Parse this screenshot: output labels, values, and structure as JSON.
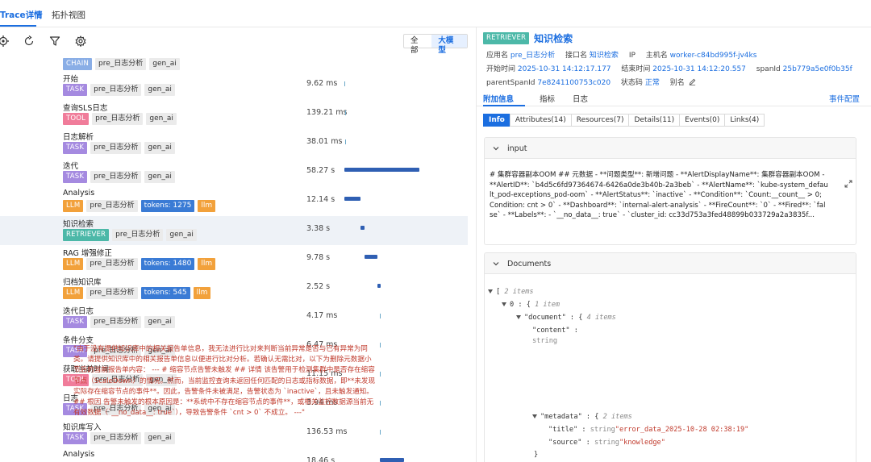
{
  "top_tabs": [
    "Trace详情",
    "拓扑视图"
  ],
  "toolbar": {
    "seg": [
      "全部",
      "大模型"
    ]
  },
  "colors": {
    "accent": "#1b6ee0",
    "task": "#a58ae0",
    "tool": "#f07c9a",
    "llm": "#f2a13b",
    "retriever": "#4cb8a8",
    "chain": "#8aaee6"
  },
  "spans": [
    {
      "name": "",
      "type": "CHAIN",
      "tags": [
        "pre_日志分析",
        "gen_ai"
      ],
      "duration": ""
    },
    {
      "name": "开始",
      "type": "TASK",
      "tags": [
        "pre_日志分析",
        "gen_ai"
      ],
      "duration": "9.62 ms"
    },
    {
      "name": "查询SLS日志",
      "type": "TOOL",
      "tags": [
        "pre_日志分析",
        "gen_ai"
      ],
      "duration": "139.21 ms"
    },
    {
      "name": "日志解析",
      "type": "TASK",
      "tags": [
        "pre_日志分析",
        "gen_ai"
      ],
      "duration": "38.01 ms"
    },
    {
      "name": "迭代",
      "type": "TASK",
      "tags": [
        "pre_日志分析",
        "gen_ai"
      ],
      "duration": "58.27 s"
    },
    {
      "name": "Analysis",
      "type": "LLM",
      "tags": [
        "pre_日志分析"
      ],
      "tokens": "tokens: 1275",
      "extra": "llm",
      "duration": "12.14 s"
    },
    {
      "name": "知识检索",
      "type": "RETRIEVER",
      "tags": [
        "pre_日志分析",
        "gen_ai"
      ],
      "duration": "3.38 s"
    },
    {
      "name": "RAG 增强修正",
      "type": "LLM",
      "tags": [
        "pre_日志分析"
      ],
      "tokens": "tokens: 1480",
      "extra": "llm",
      "duration": "9.78 s"
    },
    {
      "name": "归档知识库",
      "type": "LLM",
      "tags": [
        "pre_日志分析"
      ],
      "tokens": "tokens: 545",
      "extra": "llm",
      "duration": "2.52 s"
    },
    {
      "name": "迭代日志",
      "type": "TASK",
      "tags": [
        "pre_日志分析",
        "gen_ai"
      ],
      "duration": "4.17 ms"
    },
    {
      "name": "条件分支",
      "type": "TASK",
      "tags": [
        "pre_日志分析",
        "gen_ai"
      ],
      "duration": "6.47 ms"
    },
    {
      "name": "获取当前时间",
      "type": "TOOL",
      "tags": [
        "pre_日志分析",
        "gen_ai"
      ],
      "duration": "11.15 ms"
    },
    {
      "name": "日志",
      "type": "TASK",
      "tags": [
        "pre_日志分析",
        "gen_ai"
      ],
      "duration": "3.94 ms"
    },
    {
      "name": "知识库写入",
      "type": "TASK",
      "tags": [
        "pre_日志分析",
        "gen_ai"
      ],
      "duration": "136.53 ms"
    },
    {
      "name": "Analysis",
      "type": "",
      "tags": [],
      "duration": "18.46 s"
    }
  ],
  "detail": {
    "type_badge": "RETRIEVER",
    "title": "知识检索",
    "app_label": "应用名",
    "app": "pre_日志分析",
    "iface_label": "接口名",
    "iface": "知识检索",
    "ip_label": "IP",
    "host_label": "主机名",
    "host": "worker-c84bd995f-jv4ks",
    "start_label": "开始时间",
    "start": "2025-10-31 14:12:17.177",
    "end_label": "结束时间",
    "end": "2025-10-31 14:12:20.557",
    "spanid_label": "spanId",
    "spanid": "25b779a5e0f0b35f",
    "parent_label": "parentSpanId",
    "parent": "7e8241100753c020",
    "status_label": "状态码",
    "status": "正常",
    "alias_label": "别名"
  },
  "subtabs": [
    "附加信息",
    "指标",
    "日志"
  ],
  "event_config": "事件配置",
  "attr_tabs": [
    "Info",
    "Attributes(14)",
    "Resources(7)",
    "Details(11)",
    "Events(0)",
    "Links(4)"
  ],
  "input": {
    "label": "input",
    "text": "# 集群容器副本OOM ## 元数据 - **问题类型**: 新增问题 - **AlertDisplayName**: 集群容器副本OOM - **AlertID**: `b4d5c6fd97364674-6426a0de3b40b-2a3beb` - **AlertName**: `kube-system_default_pod-exceptions_pod-oom` - **AlertStatus**: `inactive` - **Condition**: `Count:__count__ > 0; Condition: cnt > 0` - **Dashboard**: `internal-alert-analysis` - **FireCount**: `0` - **Fired**: `false` - **Labels**: - `__no_data__: true` - `cluster_id: cc33d753a3fed48899b033729a2a3835f..."
  },
  "documents": {
    "label": "Documents",
    "root_count": "2 items",
    "idx0": "0",
    "idx0_count": "1 item",
    "doc_key": "\"document\"",
    "doc_count": "4 items",
    "content_key": "\"content\"",
    "type_string": "string",
    "content_text": "\"由于没有提供知识库中的相关报告单信息，我无法进行比对来判断当前异常是否与已有异常为同类。请提供知识库中的相关报告单信息以便进行比对分析。若确认无需比对，以下为删除元数据小节后的当前报告单内容： --- # 缩容节点告警未触发 ## 详情 该告警用于检测集群中是否存在缩容节点（ScaleDown）的情况。然而，当前监控查询未返回任何匹配的日志或指标数据，即**未发现实际存在缩容节点的事件**。因此，告警条件未被满足，告警状态为 `inactive`，且未触发通知。 ## 根因 告警未触发的根本原因是：**系统中不存在缩容节点的事件**，或相关监控数据源当前无有效数据（`__no_data__: true`），导致告警条件 `cnt > 0` 不成立。 ---\"",
    "metadata_key": "\"metadata\"",
    "metadata_count": "2 items",
    "title_key": "\"title\"",
    "title_val": "\"error_data_2025-10-28 02:38:19\"",
    "source_key": "\"source\"",
    "source_val": "\"knowledge\""
  }
}
